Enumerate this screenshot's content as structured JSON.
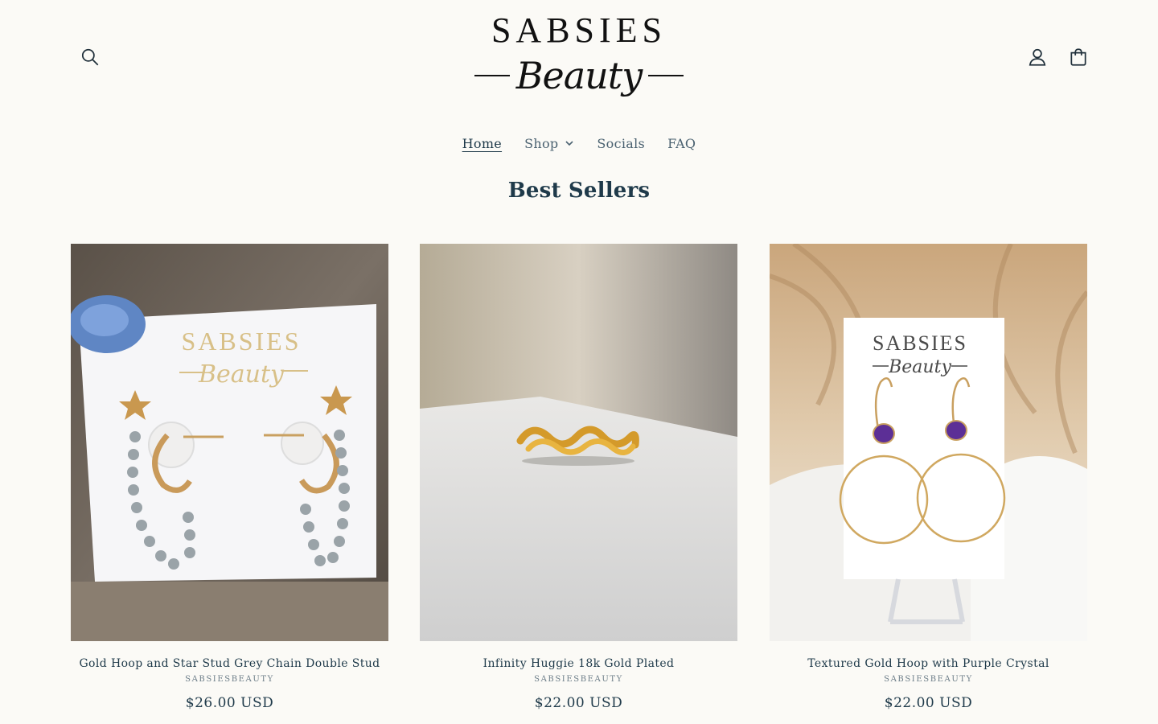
{
  "header": {
    "logo_top": "SABSIES",
    "logo_script": "Beauty",
    "search_icon": "search-icon",
    "account_icon": "account-icon",
    "cart_icon": "cart-icon"
  },
  "nav": {
    "items": [
      {
        "label": "Home",
        "active": true
      },
      {
        "label": "Shop",
        "has_dropdown": true
      },
      {
        "label": "Socials"
      },
      {
        "label": "FAQ"
      }
    ]
  },
  "section": {
    "title": "Best Sellers"
  },
  "products": [
    {
      "title": "Gold Hoop and Star Stud Grey Chain Double Stud",
      "vendor": "SABSIESBEAUTY",
      "price": "$26.00 USD",
      "card_brand_top": "SABSIES",
      "card_brand_script": "Beauty"
    },
    {
      "title": "Infinity Huggie 18k Gold Plated",
      "vendor": "SABSIESBEAUTY",
      "price": "$22.00 USD"
    },
    {
      "title": "Textured Gold Hoop with Purple Crystal",
      "vendor": "SABSIESBEAUTY",
      "price": "$22.00 USD",
      "card_brand_top": "SABSIES",
      "card_brand_script": "Beauty"
    }
  ],
  "colors": {
    "background": "#fbfaf6",
    "text": "#1f3a4a",
    "muted": "#6c7d88"
  }
}
